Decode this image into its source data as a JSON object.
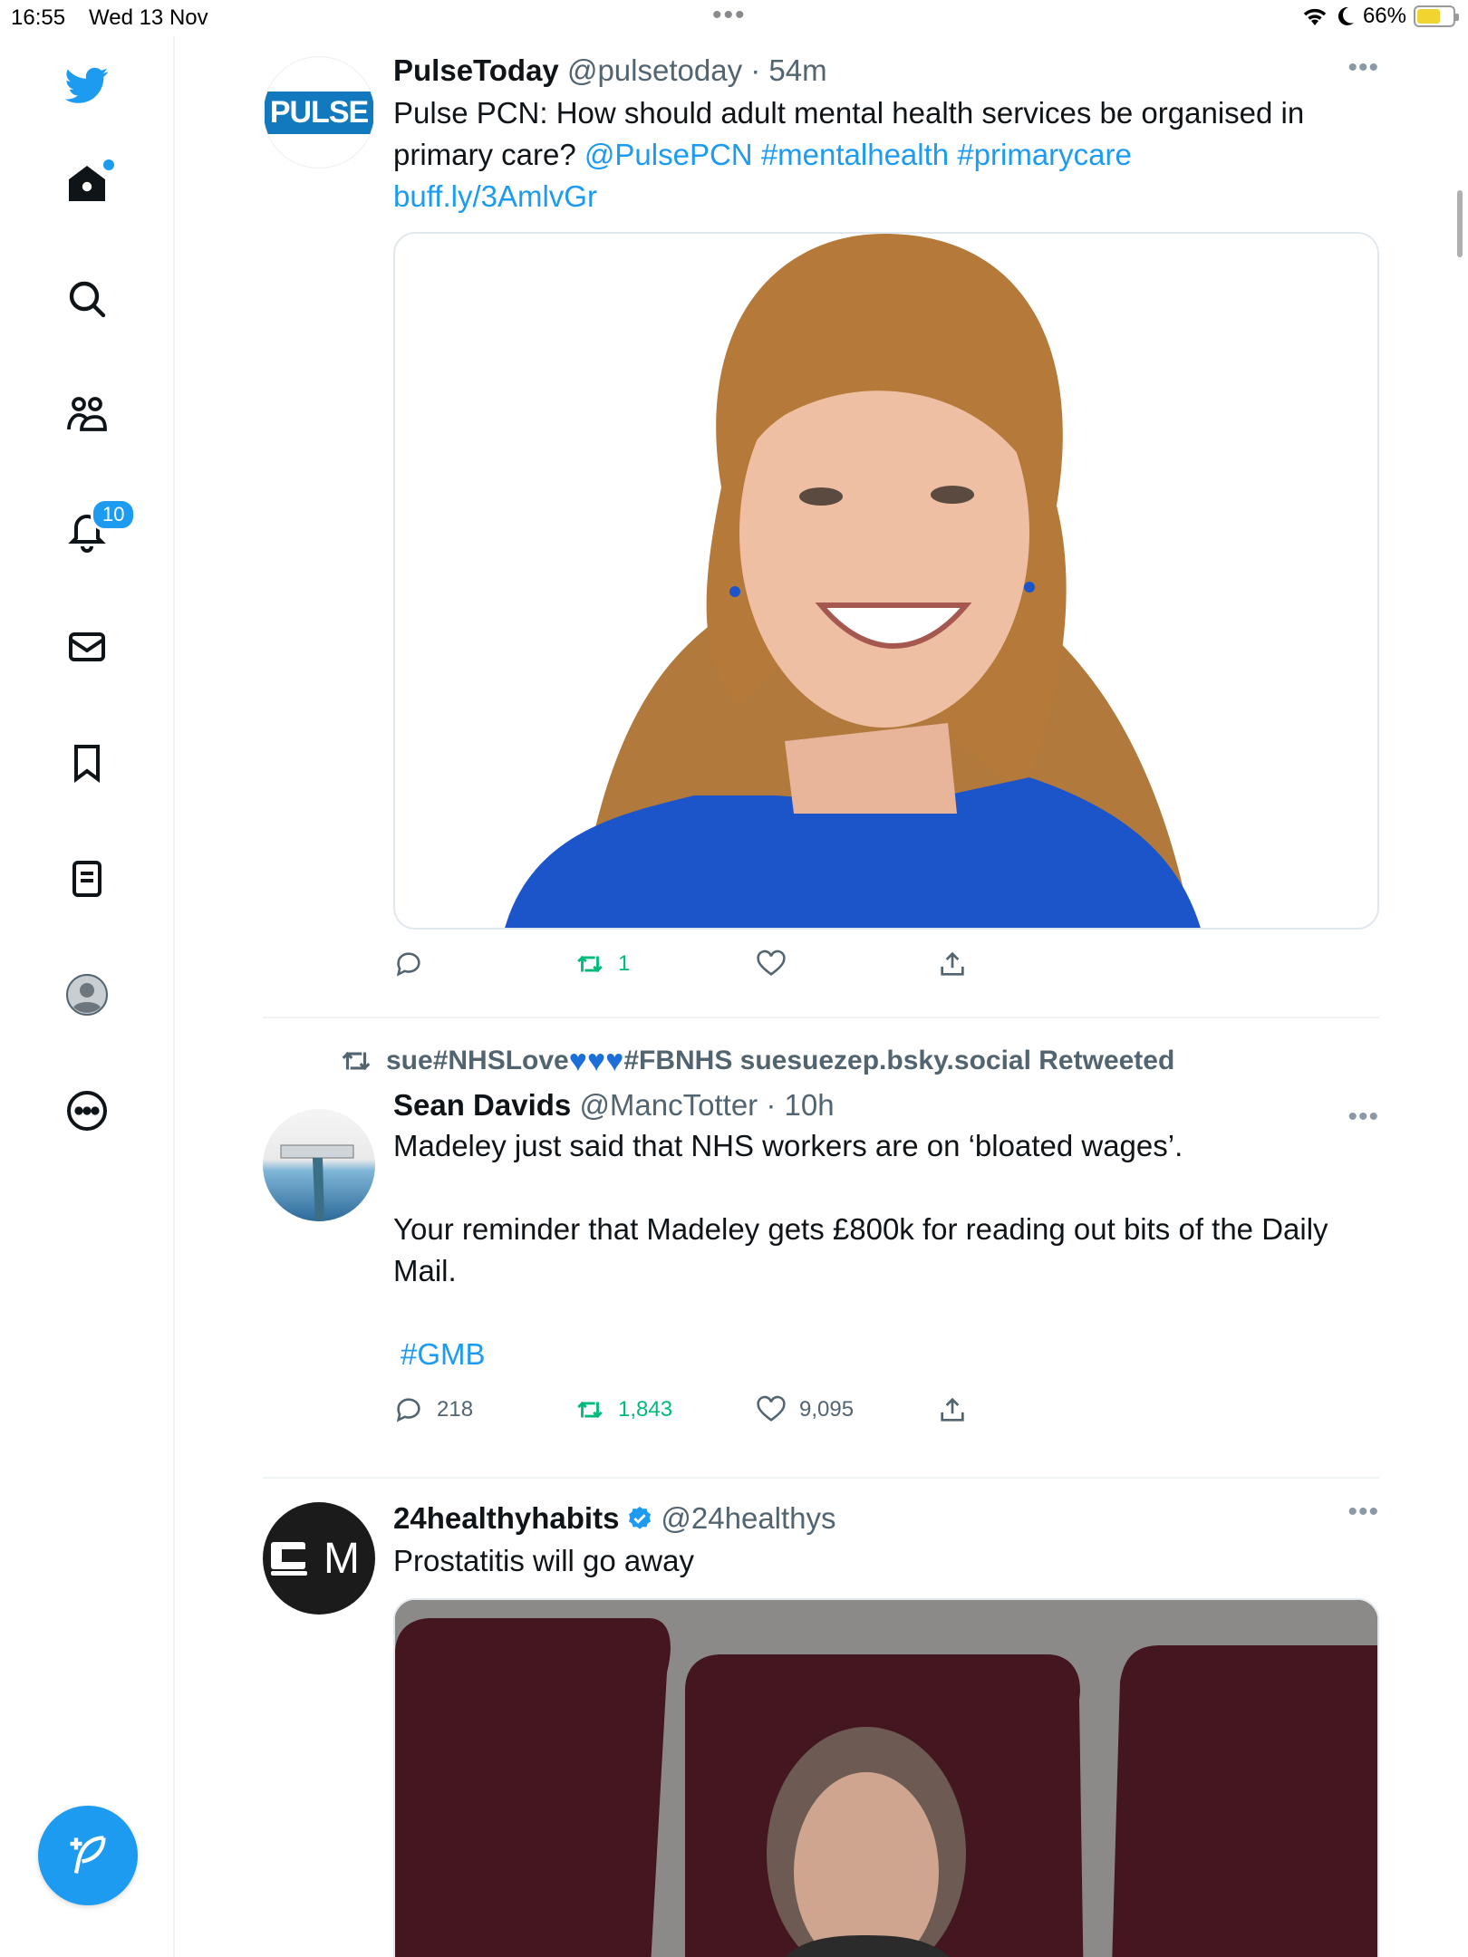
{
  "status_bar": {
    "time": "16:55",
    "date": "Wed 13 Nov",
    "battery": "66%",
    "battery_level": 0.66,
    "accent": "#1d9bf0"
  },
  "sidebar": {
    "items": [
      {
        "name": "twitter-logo-icon"
      },
      {
        "name": "home-icon"
      },
      {
        "name": "search-icon"
      },
      {
        "name": "communities-icon"
      },
      {
        "name": "notifications-icon",
        "badge": "10"
      },
      {
        "name": "messages-icon"
      },
      {
        "name": "bookmarks-icon"
      },
      {
        "name": "lists-icon"
      },
      {
        "name": "profile-icon"
      },
      {
        "name": "more-icon"
      }
    ],
    "compose": "compose-tweet-icon"
  },
  "feed": {
    "tweets": [
      {
        "name": "PulseToday",
        "handle": "@pulsetoday",
        "time": "· 54m",
        "avatar_text": "PULSE",
        "text_plain": "Pulse PCN: How should adult mental health services be organised in primary care?",
        "mention": "@PulsePCN",
        "hashtag1": "#mentalhealth",
        "hashtag2": "#primarycare",
        "link": "buff.ly/3AmlvGr",
        "replies": "",
        "retweets": "1",
        "likes": ""
      },
      {
        "retweeted_by_prefix": "sue#NHSLove",
        "retweeted_by_suffix": "#FBNHS suesuezep.bsky.social Retweeted",
        "name": "Sean Davids",
        "handle": "@MancTotter",
        "time": "· 10h",
        "line1": "Madeley just said that NHS workers are on ‘bloated wages’.",
        "line2": "Your reminder that Madeley gets £800k for reading out bits of the Daily Mail.",
        "hashtag": "#GMB",
        "replies": "218",
        "retweets": "1,843",
        "likes": "9,095"
      },
      {
        "name": "24healthyhabits",
        "handle": "@24healthys",
        "text": "Prostatitis will go away",
        "avatar_text": "M"
      }
    ]
  }
}
